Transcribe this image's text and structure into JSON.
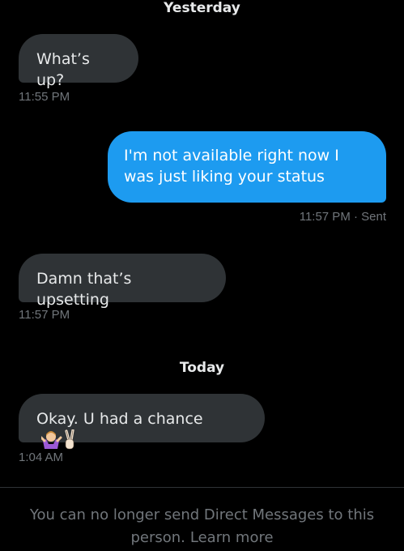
{
  "conversation": {
    "day_yesterday": "Yesterday",
    "day_today": "Today",
    "messages": [
      {
        "text": "What’s up?",
        "time": "11:55 PM"
      },
      {
        "text": "I'm not available right now I was just liking your status",
        "time": "11:57 PM · Sent"
      },
      {
        "text": "Damn that’s upsetting",
        "time": "11:57 PM"
      },
      {
        "text": "Okay. U had a chance",
        "emoji": "🤷 ✌",
        "time": "1:04 AM"
      }
    ]
  },
  "footer": {
    "notice": "You can no longer send Direct Messages to this person.",
    "link": "Learn more"
  },
  "colors": {
    "background": "#000000",
    "received_bubble": "#2f3336",
    "sent_bubble": "#1d9bf0",
    "timestamp": "#71767b",
    "link": "#1d9bf0"
  }
}
